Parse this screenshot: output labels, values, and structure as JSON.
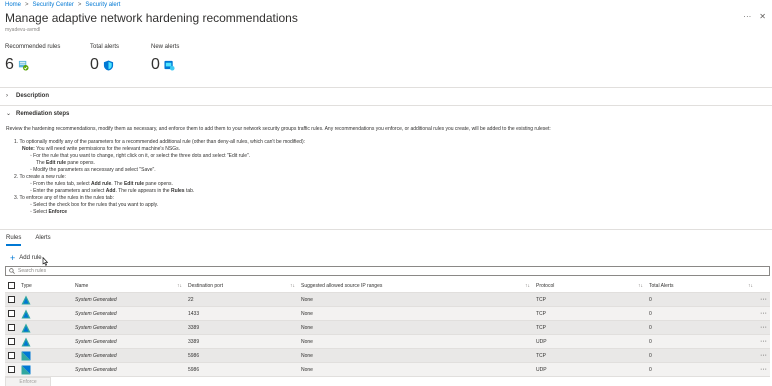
{
  "breadcrumb": {
    "items": [
      "Home",
      "Security Center",
      "Security alert"
    ],
    "separator": ">"
  },
  "page": {
    "title": "Manage adaptive network hardening recommendations",
    "subtitle": "myadevu-avmdl"
  },
  "stats": [
    {
      "label": "Recommended rules",
      "value": "6",
      "icon": "network-rules-check-icon"
    },
    {
      "label": "Total alerts",
      "value": "0",
      "icon": "shield-icon"
    },
    {
      "label": "New alerts",
      "value": "0",
      "icon": "new-alert-icon"
    }
  ],
  "sections": {
    "description": "Description",
    "remediation": "Remediation steps"
  },
  "remediation": {
    "intro": "Review the hardening recommendations, modify them as necessary, and enforce them to add them to your network security groups traffic rules. Any recommendations you enforce, or additional rules you create, will be added to the existing ruleset:",
    "step1": "1. To optionally modify any of the parameters for a recommended additional rule (other than deny-all rules, which can't be modified):",
    "note_label": "Note:",
    "note_text": " You will need write permissions for the relevant machine's NSGs.",
    "step1_a": "For the rule that you want to change, right click on it, or select the three dots and select \"Edit rule\".",
    "step1_a_cont_pre": "The ",
    "step1_a_cont_bold": "Edit rule",
    "step1_a_cont_post": " pane opens.",
    "step1_b": "Modify the parameters as necessary and select \"Save\".",
    "step2": "2. To create a new rule:",
    "step2_a_pre": "From the rules tab, select ",
    "step2_a_bold1": "Add rule",
    "step2_a_mid": ". The ",
    "step2_a_bold2": "Edit rule",
    "step2_a_post": " pane opens.",
    "step2_b_pre": "Enter the parameters and select ",
    "step2_b_bold1": "Add",
    "step2_b_mid": ". The rule appears in the ",
    "step2_b_bold2": "Rules",
    "step2_b_post": " tab.",
    "step3": "3. To enforce any of the rules in the rules tab:",
    "step3_a": "Select the check box for the rules that you want to apply.",
    "step3_b_pre": "Select ",
    "step3_b_bold": "Enforce"
  },
  "tabs": [
    "Rules",
    "Alerts"
  ],
  "toolbar": {
    "add_rule": "Add rule"
  },
  "search": {
    "placeholder": "Search rules"
  },
  "table": {
    "headers": [
      "Type",
      "Name",
      "Destination port",
      "Suggested allowed source IP ranges",
      "Protocol",
      "Total Alerts"
    ],
    "rows": [
      {
        "type_icon": "allow-rule-icon",
        "name": "System Generated",
        "port": "22",
        "source": "None",
        "protocol": "TCP",
        "alerts": "0"
      },
      {
        "type_icon": "allow-rule-icon",
        "name": "System Generated",
        "port": "1433",
        "source": "None",
        "protocol": "TCP",
        "alerts": "0"
      },
      {
        "type_icon": "allow-rule-icon",
        "name": "System Generated",
        "port": "3389",
        "source": "None",
        "protocol": "TCP",
        "alerts": "0"
      },
      {
        "type_icon": "allow-rule-icon",
        "name": "System Generated",
        "port": "3389",
        "source": "None",
        "protocol": "UDP",
        "alerts": "0"
      },
      {
        "type_icon": "deny-rule-icon",
        "name": "System Generated",
        "port": "5986",
        "source": "None",
        "protocol": "TCP",
        "alerts": "0"
      },
      {
        "type_icon": "deny-rule-icon",
        "name": "System Generated",
        "port": "5986",
        "source": "None",
        "protocol": "UDP",
        "alerts": "0"
      }
    ],
    "more_label": "···"
  },
  "footer": {
    "enforce": "Enforce"
  },
  "colors": {
    "accent": "#0078d4",
    "row_bg": "#e9e8e7"
  }
}
